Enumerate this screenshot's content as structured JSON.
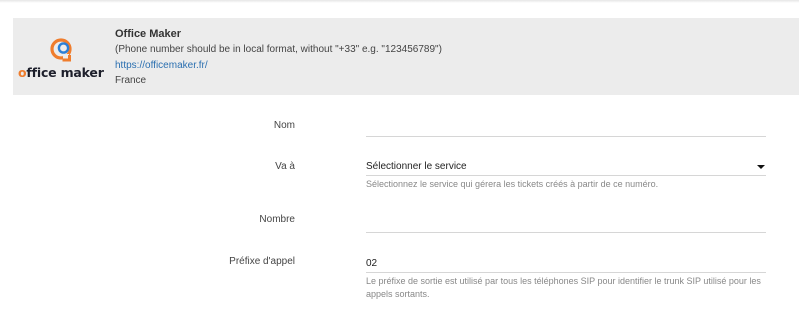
{
  "provider": {
    "name": "Office Maker",
    "logo_text": "office maker",
    "note": "(Phone number should be in local format, without \"+33\" e.g. \"123456789\")",
    "url": "https://officemaker.fr/",
    "country": "France",
    "brand_colors": {
      "orange": "#ef7d2d",
      "blue": "#2b7fd6",
      "dark": "#1d1f2b"
    }
  },
  "form": {
    "nom": {
      "label": "Nom",
      "value": ""
    },
    "va_a": {
      "label": "Va à",
      "selected": "Sélectionner le service",
      "help": "Sélectionnez le service qui gérera les tickets créés à partir de ce numéro."
    },
    "nombre": {
      "label": "Nombre",
      "value": ""
    },
    "prefixe": {
      "label": "Préfixe d'appel",
      "value": "02",
      "help": "Le préfixe de sortie est utilisé par tous les téléphones SIP pour identifier le trunk SIP utilisé pour les appels sortants."
    }
  }
}
